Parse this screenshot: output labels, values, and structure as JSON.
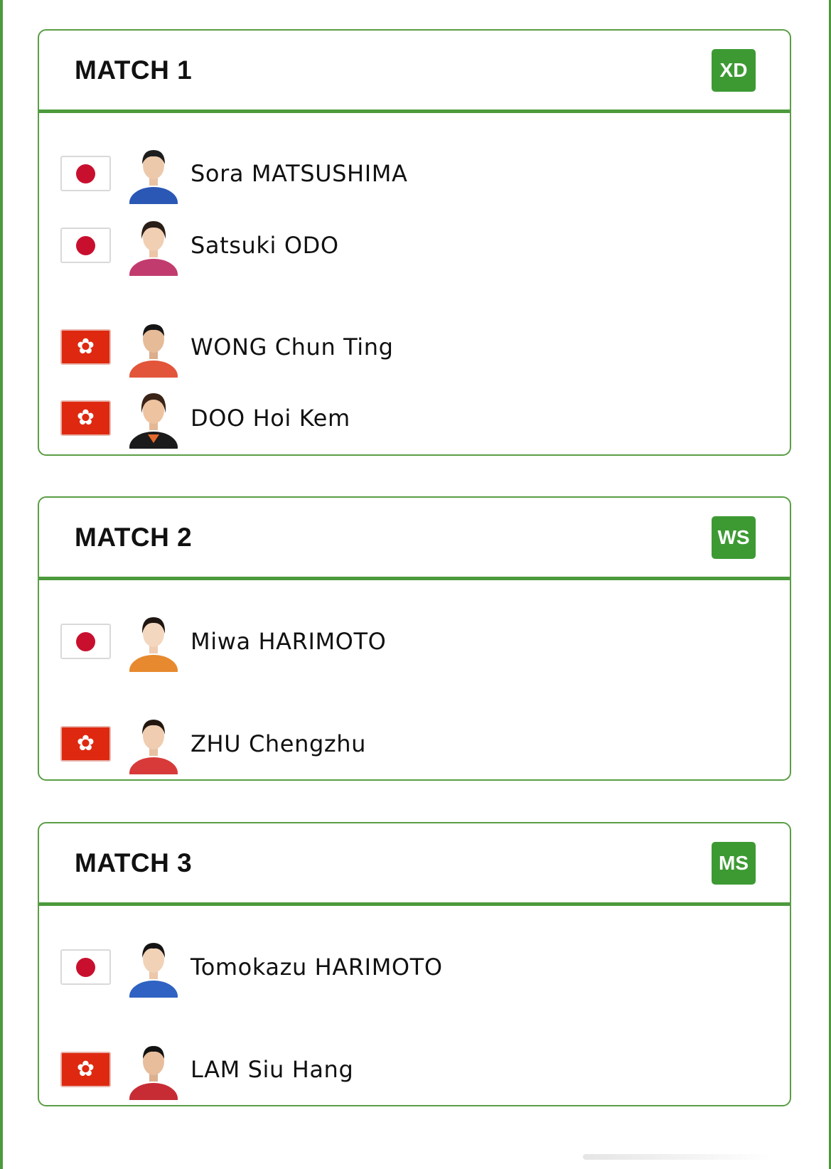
{
  "colors": {
    "accent": "#3d9a33",
    "border": "#5a9e45",
    "flag_red": "#de2910",
    "jp_red": "#c8102e"
  },
  "matches": [
    {
      "title": "MATCH 1",
      "type": "XD",
      "players": [
        {
          "name": "Sora MATSUSHIMA",
          "flag": "japan-flag-icon",
          "shirt": "#2b57b5"
        },
        {
          "name": "Satsuki ODO",
          "flag": "japan-flag-icon",
          "shirt": "#c23b6e"
        },
        {
          "name": "WONG Chun Ting",
          "flag": "hong-kong-flag-icon",
          "shirt": "#e2553a"
        },
        {
          "name": "DOO Hoi Kem",
          "flag": "hong-kong-flag-icon",
          "shirt": "#1b1b1b"
        }
      ]
    },
    {
      "title": "MATCH 2",
      "type": "WS",
      "players": [
        {
          "name": "Miwa HARIMOTO",
          "flag": "japan-flag-icon",
          "shirt": "#e7892f"
        },
        {
          "name": "ZHU Chengzhu",
          "flag": "hong-kong-flag-icon",
          "shirt": "#d83a3a"
        }
      ]
    },
    {
      "title": "MATCH 3",
      "type": "MS",
      "players": [
        {
          "name": "Tomokazu HARIMOTO",
          "flag": "japan-flag-icon",
          "shirt": "#2f62c2"
        },
        {
          "name": "LAM Siu Hang",
          "flag": "hong-kong-flag-icon",
          "shirt": "#c72c34"
        }
      ]
    }
  ]
}
